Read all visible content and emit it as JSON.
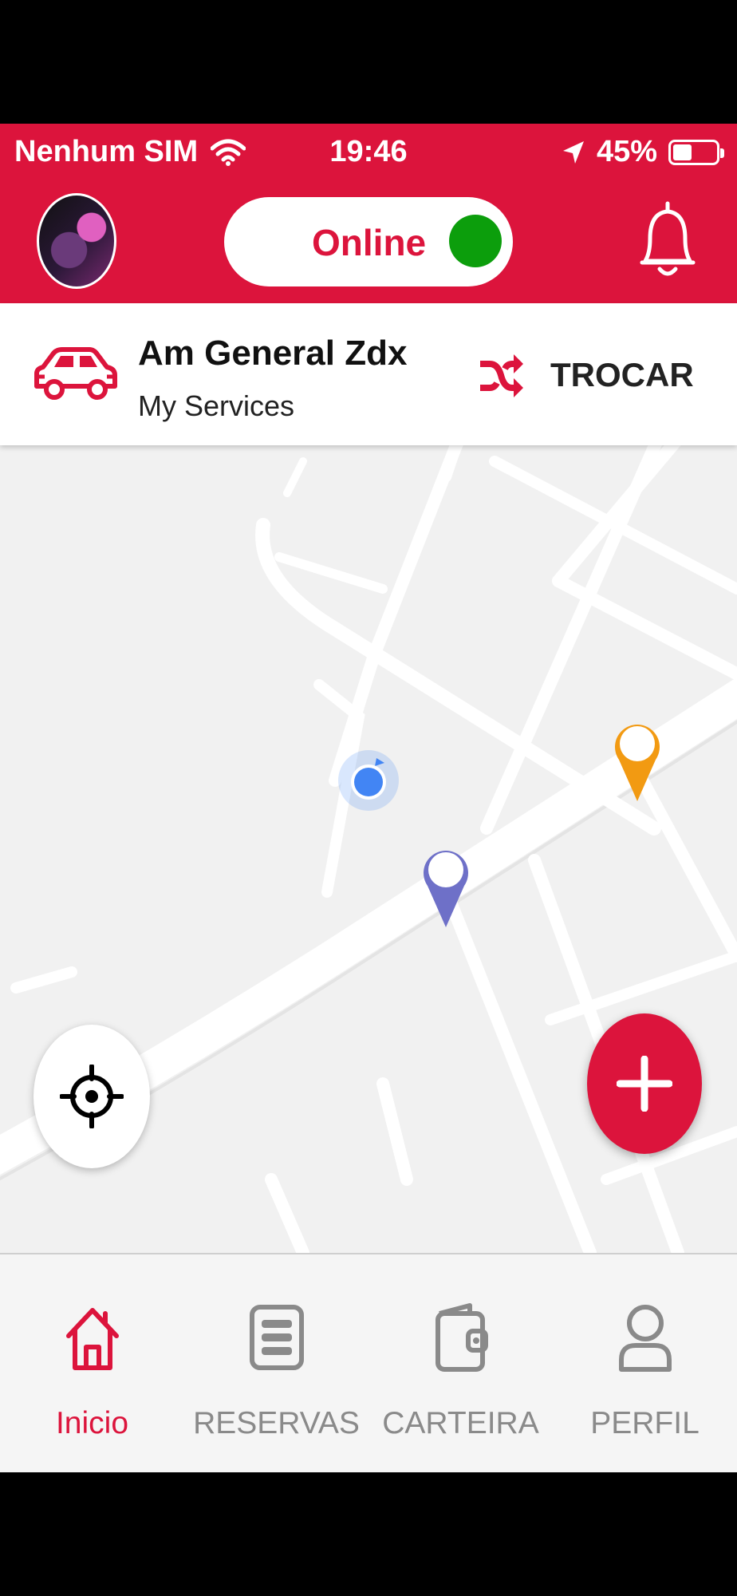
{
  "status_bar": {
    "carrier": "Nenhum SIM",
    "time": "19:46",
    "battery_percent": "45%",
    "battery_level": 0.45,
    "icons": [
      "wifi-icon",
      "location-arrow-icon",
      "battery-icon"
    ]
  },
  "header": {
    "status_toggle": {
      "label": "Online",
      "indicator_color": "#0C9E0C",
      "is_online": true
    },
    "icons": [
      "avatar",
      "bell-icon"
    ],
    "accent_color": "#DC143C"
  },
  "vehicle": {
    "name": "Am General Zdx",
    "subtitle": "My Services",
    "switch_label": "TROCAR",
    "icons": [
      "car-icon",
      "shuffle-icon"
    ]
  },
  "map": {
    "markers": [
      {
        "name": "orange-pin",
        "color": "#F29A12"
      },
      {
        "name": "purple-pin",
        "color": "#6E70C8"
      }
    ],
    "user_location_color": "#4285F4",
    "buttons": [
      "locate-me-button",
      "add-button"
    ]
  },
  "bottom_nav": {
    "items": [
      {
        "label": "Inicio",
        "icon": "home-icon",
        "active": true
      },
      {
        "label": "RESERVAS",
        "icon": "list-icon",
        "active": false
      },
      {
        "label": "CARTEIRA",
        "icon": "wallet-icon",
        "active": false
      },
      {
        "label": "PERFIL",
        "icon": "user-icon",
        "active": false
      }
    ],
    "active_color": "#DC143C",
    "inactive_color": "#8A8A8A"
  }
}
